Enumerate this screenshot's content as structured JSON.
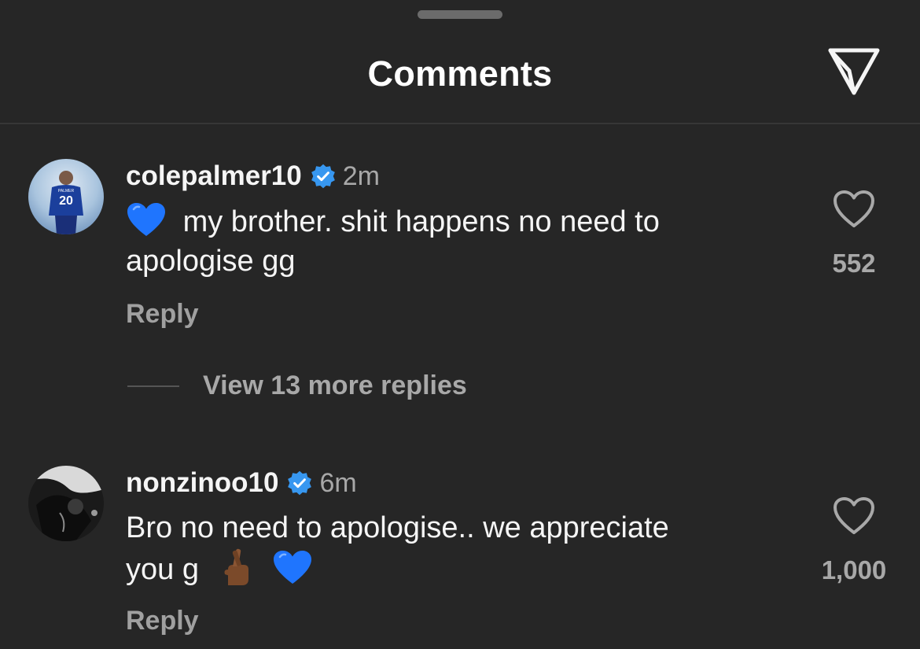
{
  "header": {
    "title": "Comments"
  },
  "comments": [
    {
      "username": "colepalmer10",
      "verified": true,
      "time": "2m",
      "text_line1": "my brother. shit happens no need to",
      "text_line2": "apologise gg",
      "reply_label": "Reply",
      "likes": "552",
      "emoji": [
        "blue-heart-icon"
      ]
    },
    {
      "username": "nonzinoo10",
      "verified": true,
      "time": "6m",
      "text_line1": "Bro no need to apologise.. we appreciate",
      "text_line2": "you g",
      "reply_label": "Reply",
      "likes": "1,000",
      "emoji": [
        "crossed-fingers-icon",
        "blue-heart-icon"
      ]
    }
  ],
  "view_more_replies": "View 13 more replies",
  "colors": {
    "background": "#262626",
    "text": "#f5f5f5",
    "muted": "#a8a8a8",
    "verified": "#3797f0",
    "heart": "#1f75fe"
  }
}
